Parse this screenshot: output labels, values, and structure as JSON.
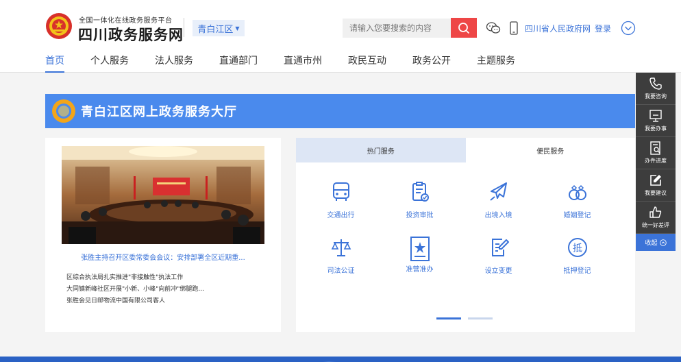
{
  "header": {
    "logo_subtitle": "全国一体化在线政务服务平台",
    "logo_title": "四川政务服务网",
    "region": "青白江区",
    "search_placeholder": "请输入您要搜索的内容",
    "gov_link": "四川省人民政府网",
    "login": "登录"
  },
  "nav": [
    "首页",
    "个人服务",
    "法人服务",
    "直通部门",
    "直通市州",
    "政民互动",
    "政务公开",
    "主题服务"
  ],
  "hall": {
    "title": "青白江区网上政务服务大厅"
  },
  "news": {
    "caption": "张胜主持召开区委常委会会议：安排部署全区近期重...",
    "items": [
      "区综合执法局扎实推进\"非接触性\"执法工作",
      "大同镇新峰社区开展\"小新、小峰\"向前冲\"绑腿跑...",
      "张胜会见日邮物流中国有限公司客人"
    ]
  },
  "services": {
    "tabs": [
      "热门服务",
      "便民服务"
    ],
    "active_tab": "便民服务",
    "items": [
      {
        "label": "交通出行",
        "icon": "bus-icon"
      },
      {
        "label": "投资审批",
        "icon": "clipboard-check-icon"
      },
      {
        "label": "出境入境",
        "icon": "airplane-icon"
      },
      {
        "label": "婚姻登记",
        "icon": "rings-icon"
      },
      {
        "label": "司法公证",
        "icon": "scales-icon"
      },
      {
        "label": "准营准办",
        "icon": "certificate-star-icon"
      },
      {
        "label": "设立变更",
        "icon": "edit-document-icon"
      },
      {
        "label": "抵押登记",
        "icon": "mortgage-icon"
      }
    ],
    "mortgage_glyph": "抵",
    "pages": 2,
    "current_page": 1
  },
  "sidebar": {
    "items": [
      {
        "label": "我要咨询",
        "icon": "phone-icon"
      },
      {
        "label": "我要办事",
        "icon": "monitor-icon"
      },
      {
        "label": "办件进度",
        "icon": "search-document-icon"
      },
      {
        "label": "我要建议",
        "icon": "edit-icon"
      },
      {
        "label": "统一好差评",
        "icon": "thumbs-up-icon"
      }
    ],
    "collapse": "收起"
  },
  "colors": {
    "accent": "#3b73d8",
    "banner": "#4a8aed",
    "search_button": "#ee4646",
    "sidebar": "#3d3d3d"
  }
}
